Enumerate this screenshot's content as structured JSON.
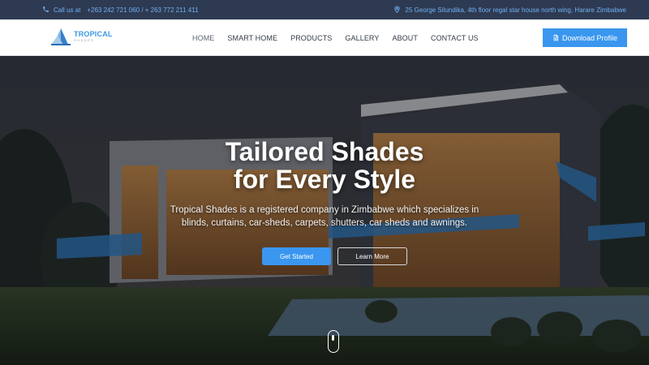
{
  "topbar": {
    "phone_label": "Call us at",
    "phones": "+263 242 721 060 / + 263 772 211 411",
    "address": "25 George Silundika, 4th floor regal star house north wing, Harare Zimbabwe"
  },
  "brand": {
    "name": "TROPICAL",
    "sub": "SHADES"
  },
  "nav": {
    "items": [
      "HOME",
      "SMART HOME",
      "PRODUCTS",
      "GALLERY",
      "ABOUT",
      "CONTACT US"
    ],
    "download_label": "Download Profile"
  },
  "hero": {
    "title_line1": "Tailored Shades",
    "title_line2": "for Every Style",
    "desc_line1": "Tropical Shades is a registered company in Zimbabwe which specializes in",
    "desc_line2": "blinds, curtains, car-sheds, carpets, shutters, car sheds and awnings.",
    "primary_button": "Get Started",
    "secondary_button": "Learn More"
  },
  "colors": {
    "accent": "#3a96ef",
    "topbar_bg": "#2e3a52",
    "topbar_text": "#6fb0f0"
  },
  "icons": {
    "phone": "phone-icon",
    "location": "map-pin-icon",
    "file": "file-icon"
  }
}
